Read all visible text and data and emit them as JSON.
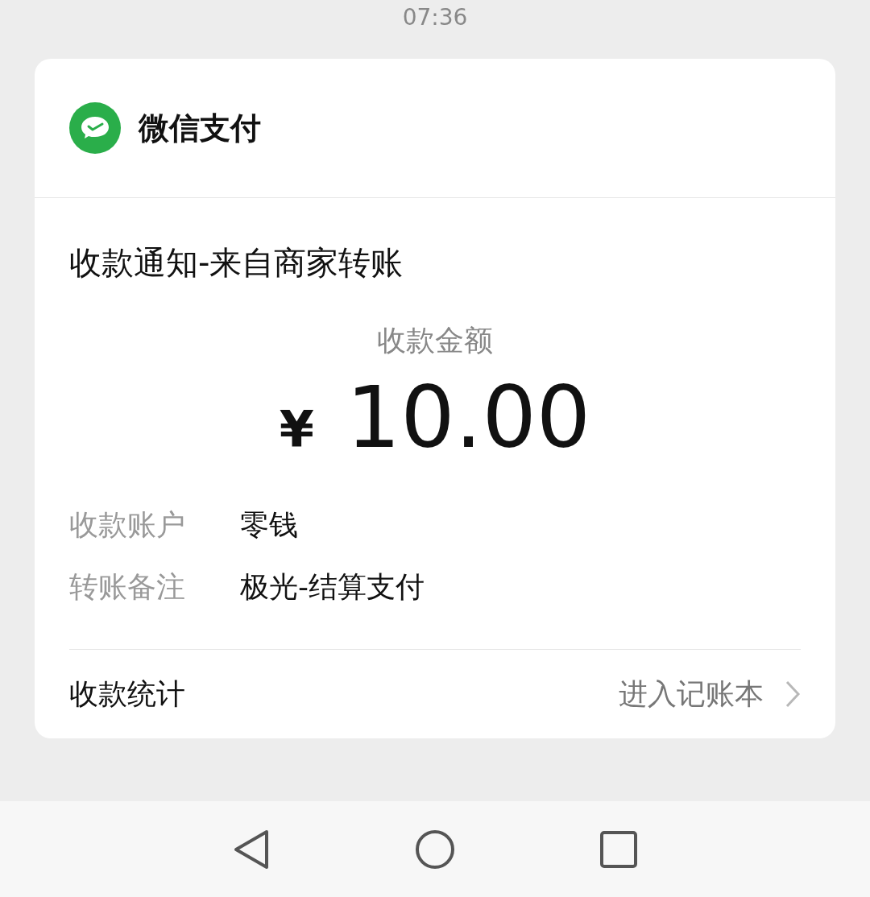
{
  "status_bar": {
    "time": "07:36"
  },
  "card": {
    "app_name": "微信支付",
    "title": "收款通知-来自商家转账",
    "amount_label": "收款金额",
    "currency": "¥",
    "amount": "10.00",
    "details": [
      {
        "label": "收款账户",
        "value": "零钱"
      },
      {
        "label": "转账备注",
        "value": "极光-结算支付"
      }
    ],
    "footer": {
      "label": "收款统计",
      "link": "进入记账本"
    }
  }
}
